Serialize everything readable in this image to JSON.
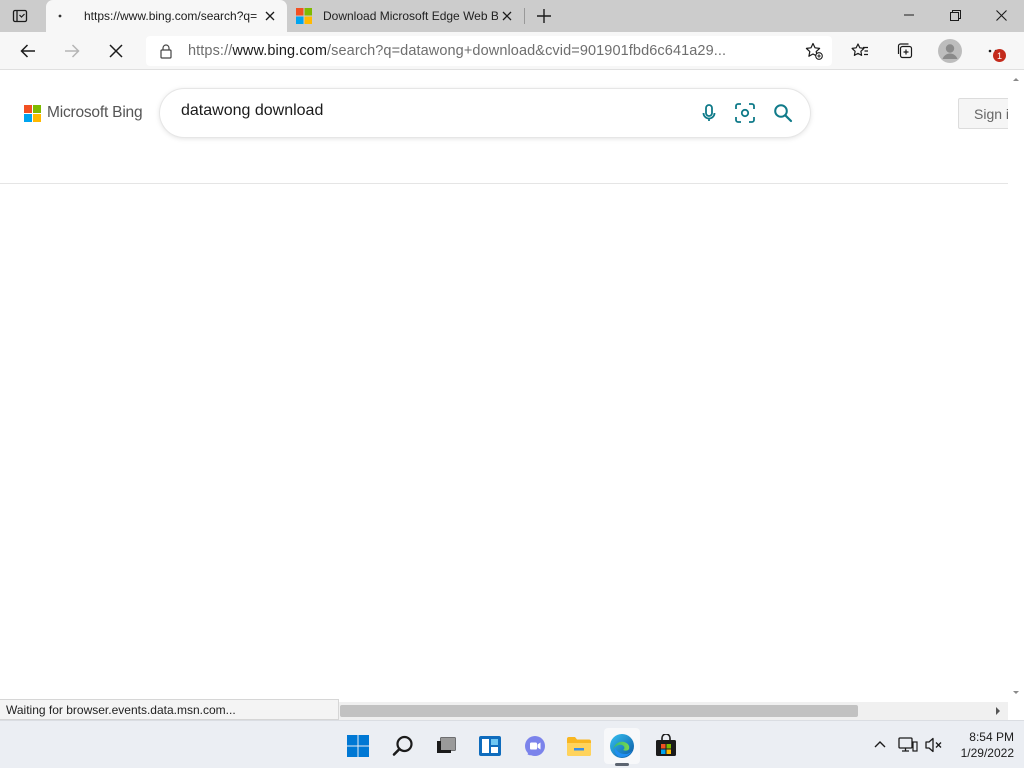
{
  "browser": {
    "tabs": [
      {
        "title": "https://www.bing.com/search?q=",
        "active": true
      },
      {
        "title": "Download Microsoft Edge Web B",
        "active": false
      }
    ],
    "address": {
      "prefix": "https://",
      "host": "www.bing.com",
      "rest": "/search?q=datawong+download&cvid=901901fbd6c641a29..."
    },
    "notification_count": "1",
    "status_text": "Waiting for browser.events.data.msn.com..."
  },
  "page": {
    "logo_text": "Microsoft Bing",
    "search_value": "datawong download",
    "sign_in": "Sign in"
  },
  "taskbar": {
    "time": "8:54 PM",
    "date": "1/29/2022"
  },
  "colors": {
    "bing_teal": "#0f7a89",
    "ms_red": "#f25022",
    "ms_green": "#7fba00",
    "ms_blue": "#00a4ef",
    "ms_yellow": "#ffb900"
  }
}
